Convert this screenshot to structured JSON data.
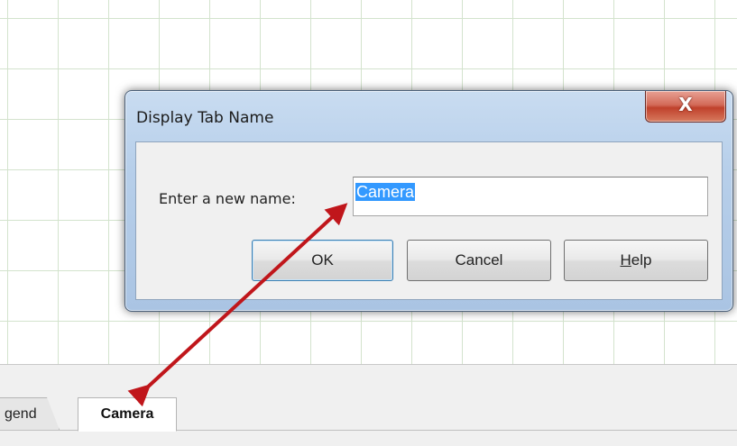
{
  "dialog": {
    "title": "Display Tab Name",
    "close_glyph": "X",
    "field_label": "Enter a new name:",
    "name_value": "Camera",
    "buttons": {
      "ok": "OK",
      "cancel": "Cancel",
      "help_accel": "H",
      "help_rest": "elp"
    }
  },
  "tabs": [
    {
      "label": "gend",
      "active": false
    },
    {
      "label": "Camera",
      "active": true
    }
  ],
  "annotation": {
    "arrow_color": "#c0161b"
  },
  "colors": {
    "grid_line": "#d3e3cd",
    "selection": "#3399ff",
    "close_button": "#c0412c",
    "dialog_frame": "#b7cfea"
  }
}
